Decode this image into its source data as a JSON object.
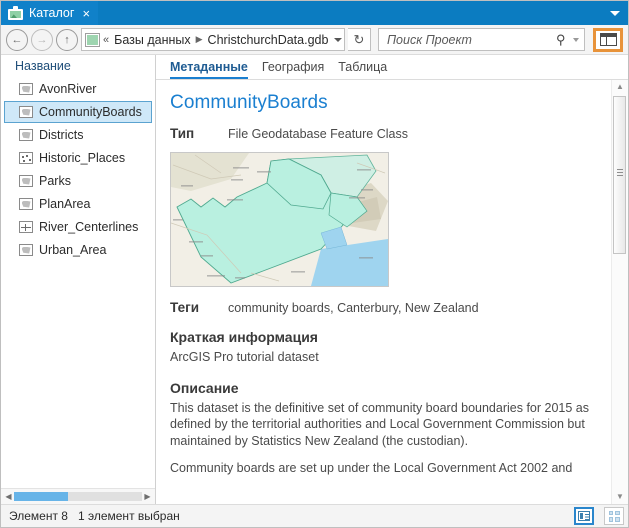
{
  "window": {
    "tab_title": "Каталог",
    "tab_icon": "catalog-icon",
    "close_icon": "×",
    "overflow_icon": "chevron-down-icon",
    "accent_color": "#0b7cc1"
  },
  "toolbar": {
    "back_icon": "←",
    "forward_icon": "→",
    "up_icon": "↑",
    "breadcrumb_icon": "geodatabase-icon",
    "overflow_chevrons": "«",
    "breadcrumbs": [
      "Базы данных",
      "ChristchurchData.gdb"
    ],
    "breadcrumb_separator": "▶",
    "dropdown_icon": "chevron-down-icon",
    "refresh_icon": "↻",
    "panel_toggle_icon": "panel-layout-icon",
    "panel_toggle_highlight": "#e8933a"
  },
  "search": {
    "placeholder": "Поиск Проект",
    "value": "",
    "icon": "search-icon",
    "dropdown_icon": "chevron-down-icon"
  },
  "sidebar": {
    "column_header": "Название",
    "items": [
      {
        "label": "AvonRiver",
        "icon": "polygon-feature-icon",
        "selected": false
      },
      {
        "label": "CommunityBoards",
        "icon": "polygon-feature-icon",
        "selected": true
      },
      {
        "label": "Districts",
        "icon": "polygon-feature-icon",
        "selected": false
      },
      {
        "label": "Historic_Places",
        "icon": "point-feature-icon",
        "selected": false
      },
      {
        "label": "Parks",
        "icon": "polygon-feature-icon",
        "selected": false
      },
      {
        "label": "PlanArea",
        "icon": "polygon-feature-icon",
        "selected": false
      },
      {
        "label": "River_Centerlines",
        "icon": "line-feature-icon",
        "selected": false
      },
      {
        "label": "Urban_Area",
        "icon": "polygon-feature-icon",
        "selected": false
      }
    ],
    "selection_color": "#cfe8f8",
    "hscroll": {
      "left_arrow": "◀",
      "right_arrow": "▶",
      "thumb_color": "#67b4e8"
    }
  },
  "content": {
    "tabs": [
      {
        "label": "Метаданные",
        "active": true
      },
      {
        "label": "География",
        "active": false
      },
      {
        "label": "Таблица",
        "active": false
      }
    ],
    "title": "CommunityBoards",
    "fields": [
      {
        "key": "Тип",
        "value": "File Geodatabase Feature Class"
      },
      {
        "key": "Теги",
        "value": "community boards, Canterbury, New Zealand"
      }
    ],
    "thumbnail_name": "map-thumbnail",
    "sections": [
      {
        "heading": "Краткая информация",
        "paragraphs": [
          "ArcGIS Pro tutorial dataset"
        ]
      },
      {
        "heading": "Описание",
        "paragraphs": [
          "This dataset is the definitive set of community board boundaries for 2015 as defined by the territorial authorities and Local Government Commission but maintained by Statistics New Zealand (the custodian).",
          "Community boards are set up under the Local Government Act 2002 and"
        ]
      }
    ],
    "scrollbar": {
      "up_arrow": "▲",
      "down_arrow": "▼"
    }
  },
  "status": {
    "item_count_text": "Элемент 8",
    "selection_text": "1 элемент выбран",
    "view_buttons": [
      {
        "icon": "list-view-icon",
        "selected": true
      },
      {
        "icon": "grid-view-icon",
        "selected": false
      }
    ]
  }
}
